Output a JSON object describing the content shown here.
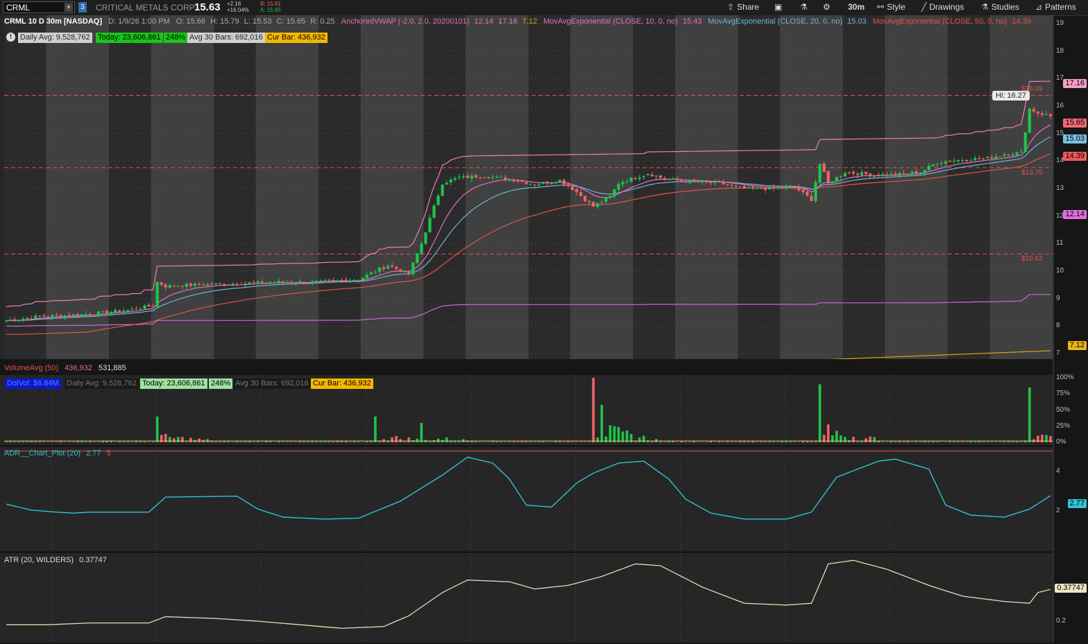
{
  "toolbar": {
    "symbol": "CRML",
    "link_badge": "3",
    "company": "CRITICAL METALS CORP",
    "last": "15.63",
    "change": "+2.16",
    "change_pct": "+16.04%",
    "bid": "B: 15.61",
    "ask": "A: 15.65",
    "share": "Share",
    "timeframe": "30m",
    "style": "Style",
    "drawings": "Drawings",
    "studies": "Studies",
    "patterns": "Patterns"
  },
  "colors": {
    "up": "#1fc54a",
    "down": "#f0616a",
    "ema10": "#e66fc4",
    "ema20": "#6fb4d9",
    "ema50": "#e5524f",
    "vwap_upper": "#ef7fb6",
    "vwap_lower": "#c86cd8",
    "vwap_mid": "#d6a614",
    "adr": "#2fc4d4",
    "atr": "#e9dcb5"
  },
  "price_header": {
    "title": "CRML 10 D 30m [NASDAQ]",
    "date": "D: 1/9/26 1:00 PM",
    "open": "O: 15.66",
    "high": "H: 15.79",
    "low": "L: 15.53",
    "close": "C: 15.65",
    "range": "R: 0.25",
    "vwap_name": "AnchoredVWAP (-2.0, 2.0, 20200101)",
    "vwap_v1": "12.14",
    "vwap_v2": "17.16",
    "vwap_v3": "7.12",
    "ema10_name": "MovAvgExponential (CLOSE, 10, 0, no)",
    "ema10_val": "15.43",
    "ema20_name": "MovAvgExponential (CLOSE, 20, 0, no)",
    "ema20_val": "15.03",
    "ema50_name": "MovAvgExponential (CLOSE, 50, 0, no)",
    "ema50_val": "14.39"
  },
  "stats_bar": {
    "daily_avg": "Daily Avg: 9,528,762",
    "today": "Today: 23,606,861",
    "pct": "248%",
    "avg30": "Avg 30 Bars: 692,016",
    "cur_bar": "Cur Bar: 436,932"
  },
  "volume_header": {
    "name": "VolumeAvg (50)",
    "v1": "436,932",
    "v2": "531,885",
    "dolvol": "DolVol: $6.84M"
  },
  "adr_header": {
    "name": "ADR__Chart_Plot (20)",
    "v1": "2.77",
    "v2": "5"
  },
  "atr_header": {
    "name": "ATR (20, WILDERS)",
    "v1": "0.37747"
  },
  "price_axis": {
    "ticks": [
      "19",
      "18",
      "17",
      "16",
      "15",
      "14",
      "13",
      "12",
      "11",
      "10",
      "9",
      "8",
      "7"
    ],
    "labels": {
      "vwap_upper": "17.16",
      "close": "15.65",
      "ema20": "15.03",
      "ema50": "14.39",
      "vwap_lower": "12.14",
      "vwap_mid": "7.12"
    },
    "hi_bubble": "Hi: 16.27",
    "levels": [
      {
        "price": 16.39,
        "text": "$16.39"
      },
      {
        "price": 13.76,
        "text": "$13.76"
      },
      {
        "price": 10.62,
        "text": "$10.62"
      }
    ]
  },
  "volume_axis": {
    "ticks": [
      "100%",
      "75%",
      "50%",
      "25%",
      "0%"
    ]
  },
  "adr_axis": {
    "ticks": [
      "4",
      "2"
    ],
    "label": "2.77"
  },
  "atr_axis": {
    "ticks": [
      "0.2"
    ],
    "label": "0.37747"
  },
  "chart_data": [
    {
      "type": "candlestick",
      "title": "CRML 10 D 30m [NASDAQ]",
      "ylim": [
        6.8,
        19.3
      ],
      "sessions": 10,
      "close_path": [
        [
          0,
          8.2
        ],
        [
          8,
          8.35
        ],
        [
          16,
          8.4
        ],
        [
          24,
          8.5
        ],
        [
          30,
          8.6
        ],
        [
          35,
          8.75
        ],
        [
          36,
          9.6
        ],
        [
          38,
          9.45
        ],
        [
          45,
          9.5
        ],
        [
          55,
          9.55
        ],
        [
          65,
          9.6
        ],
        [
          75,
          9.6
        ],
        [
          84,
          9.7
        ],
        [
          88,
          10.0
        ],
        [
          91,
          10.2
        ],
        [
          96,
          9.9
        ],
        [
          99,
          11.0
        ],
        [
          101,
          11.9
        ],
        [
          104,
          13.2
        ],
        [
          108,
          13.4
        ],
        [
          114,
          13.45
        ],
        [
          120,
          13.35
        ],
        [
          126,
          13.15
        ],
        [
          132,
          13.3
        ],
        [
          135,
          13.0
        ],
        [
          138,
          12.6
        ],
        [
          140,
          12.35
        ],
        [
          144,
          12.7
        ],
        [
          146,
          13.2
        ],
        [
          150,
          13.4
        ],
        [
          153,
          13.55
        ],
        [
          157,
          13.35
        ],
        [
          163,
          13.25
        ],
        [
          170,
          13.2
        ],
        [
          176,
          13.0
        ],
        [
          182,
          13.0
        ],
        [
          188,
          13.05
        ],
        [
          192,
          12.6
        ],
        [
          194,
          13.9
        ],
        [
          196,
          13.2
        ],
        [
          200,
          13.6
        ],
        [
          206,
          13.5
        ],
        [
          212,
          13.5
        ],
        [
          218,
          13.6
        ],
        [
          222,
          13.95
        ],
        [
          228,
          14.05
        ],
        [
          234,
          14.1
        ],
        [
          238,
          14.25
        ],
        [
          242,
          14.3
        ],
        [
          244,
          15.9
        ],
        [
          246,
          15.75
        ],
        [
          249,
          15.63
        ]
      ],
      "volume_pct_spikes": [
        {
          "bar": 36,
          "pct": 40
        },
        {
          "bar": 88,
          "pct": 40
        },
        {
          "bar": 99,
          "pct": 30
        },
        {
          "bar": 140,
          "pct": 100
        },
        {
          "bar": 142,
          "pct": 58
        },
        {
          "bar": 194,
          "pct": 90
        },
        {
          "bar": 244,
          "pct": 85
        }
      ]
    },
    {
      "type": "line",
      "title": "ADR__Chart_Plot (20)",
      "ylim": [
        0,
        5.2
      ],
      "points": [
        [
          0,
          2.35
        ],
        [
          6,
          2.05
        ],
        [
          12,
          1.95
        ],
        [
          16,
          1.9
        ],
        [
          20,
          1.95
        ],
        [
          34,
          1.95
        ],
        [
          38,
          2.7
        ],
        [
          55,
          2.75
        ],
        [
          60,
          2.1
        ],
        [
          66,
          1.7
        ],
        [
          76,
          1.6
        ],
        [
          84,
          1.65
        ],
        [
          94,
          2.5
        ],
        [
          104,
          3.8
        ],
        [
          110,
          4.7
        ],
        [
          116,
          4.4
        ],
        [
          120,
          3.6
        ],
        [
          124,
          2.3
        ],
        [
          130,
          2.2
        ],
        [
          136,
          3.4
        ],
        [
          140,
          3.9
        ],
        [
          146,
          4.4
        ],
        [
          152,
          4.5
        ],
        [
          158,
          3.6
        ],
        [
          162,
          2.6
        ],
        [
          168,
          1.9
        ],
        [
          176,
          1.6
        ],
        [
          186,
          1.6
        ],
        [
          192,
          1.95
        ],
        [
          198,
          3.7
        ],
        [
          208,
          4.5
        ],
        [
          212,
          4.6
        ],
        [
          220,
          4.1
        ],
        [
          224,
          2.3
        ],
        [
          230,
          1.8
        ],
        [
          238,
          1.7
        ],
        [
          244,
          2.1
        ],
        [
          249,
          2.77
        ]
      ]
    },
    {
      "type": "line",
      "title": "ATR (20, WILDERS)",
      "ylim": [
        0.08,
        0.58
      ],
      "points": [
        [
          0,
          0.18
        ],
        [
          10,
          0.18
        ],
        [
          20,
          0.19
        ],
        [
          34,
          0.19
        ],
        [
          38,
          0.225
        ],
        [
          50,
          0.215
        ],
        [
          60,
          0.2
        ],
        [
          70,
          0.18
        ],
        [
          80,
          0.16
        ],
        [
          90,
          0.17
        ],
        [
          96,
          0.23
        ],
        [
          104,
          0.36
        ],
        [
          110,
          0.43
        ],
        [
          120,
          0.42
        ],
        [
          126,
          0.38
        ],
        [
          134,
          0.4
        ],
        [
          142,
          0.45
        ],
        [
          150,
          0.52
        ],
        [
          156,
          0.51
        ],
        [
          166,
          0.39
        ],
        [
          176,
          0.3
        ],
        [
          186,
          0.29
        ],
        [
          192,
          0.3
        ],
        [
          196,
          0.52
        ],
        [
          202,
          0.54
        ],
        [
          210,
          0.49
        ],
        [
          220,
          0.4
        ],
        [
          228,
          0.34
        ],
        [
          238,
          0.31
        ],
        [
          244,
          0.3
        ],
        [
          246,
          0.36
        ],
        [
          249,
          0.37747
        ]
      ]
    }
  ]
}
